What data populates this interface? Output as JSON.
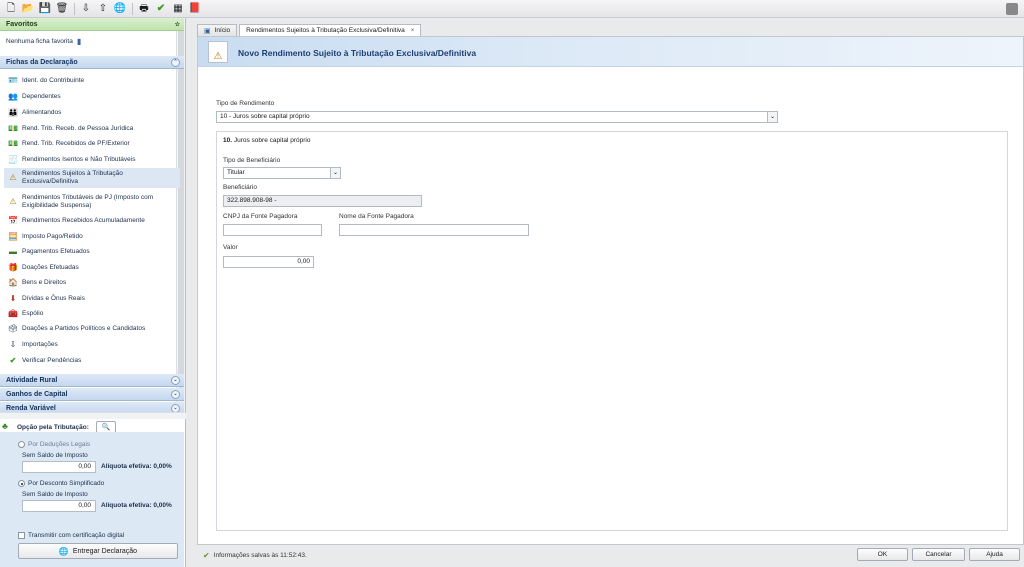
{
  "toolbar": {
    "icons": [
      "new-document",
      "open-folder",
      "save",
      "delete",
      "import",
      "export",
      "globe",
      "print",
      "verify",
      "calculator",
      "book"
    ]
  },
  "sidebar": {
    "favorites_header": "Favoritos",
    "favorites_empty": "Nenhuma ficha favorita",
    "fichas_header": "Fichas da Declaração",
    "items": [
      {
        "label": "Ident. do Contribuinte"
      },
      {
        "label": "Dependentes"
      },
      {
        "label": "Alimentandos"
      },
      {
        "label": "Rend. Trib. Receb. de Pessoa Jurídica"
      },
      {
        "label": "Rend. Trib. Recebidos de PF/Exterior"
      },
      {
        "label": "Rendimentos Isentos e Não Tributáveis"
      },
      {
        "label": "Rendimentos Sujeitos à Tributação Exclusiva/Definitiva"
      },
      {
        "label": "Rendimentos Tributáveis de PJ (Imposto com Exigibilidade Suspensa)"
      },
      {
        "label": "Rendimentos Recebidos Acumuladamente"
      },
      {
        "label": "Imposto Pago/Retido"
      },
      {
        "label": "Pagamentos Efetuados"
      },
      {
        "label": "Doações Efetuadas"
      },
      {
        "label": "Bens e Direitos"
      },
      {
        "label": "Dívidas e Ônus Reais"
      },
      {
        "label": "Espólio"
      },
      {
        "label": "Doações a Partidos Políticos e Candidatos"
      },
      {
        "label": "Importações"
      },
      {
        "label": "Verificar Pendências"
      }
    ],
    "section_rural": "Atividade Rural",
    "section_ganhos": "Ganhos de Capital",
    "section_renda": "Renda Variável"
  },
  "tax_option": {
    "title": "Opção pela Tributação:",
    "deducoes_label": "Por Deduções Legais",
    "deducoes_sub": "Sem Saldo de Imposto",
    "deducoes_value": "0,00",
    "deducoes_rate": "Alíquota efetiva: 0,00%",
    "simplificado_label": "Por Desconto Simplificado",
    "simplificado_sub": "Sem Saldo de Imposto",
    "simplificado_value": "0,00",
    "simplificado_rate": "Alíquota efetiva: 0,00%",
    "cert_label": "Transmitir com certificação digital",
    "submit_label": "Entregar Declaração"
  },
  "tabs": [
    {
      "label": "Início"
    },
    {
      "label": "Rendimentos Sujeitos à Tributação Exclusiva/Definitiva"
    }
  ],
  "form": {
    "title": "Novo Rendimento Sujeito à Tributação Exclusiva/Definitiva",
    "tipo_rendimento_label": "Tipo de Rendimento",
    "tipo_rendimento_value": "10 - Juros sobre capital próprio",
    "section_number": "10.",
    "section_title": "Juros sobre capital próprio",
    "tipo_beneficiario_label": "Tipo de Beneficiário",
    "tipo_beneficiario_value": "Titular",
    "beneficiario_label": "Beneficiário",
    "beneficiario_value": "322.898.908-98 -",
    "cnpj_label": "CNPJ da Fonte Pagadora",
    "cnpj_value": "",
    "nome_fonte_label": "Nome da Fonte Pagadora",
    "nome_fonte_value": "",
    "valor_label": "Valor",
    "valor_value": "0,00"
  },
  "status": {
    "message": "Informações salvas às 11:52:43."
  },
  "buttons": {
    "ok": "OK",
    "cancel": "Cancelar",
    "help": "Ajuda"
  }
}
